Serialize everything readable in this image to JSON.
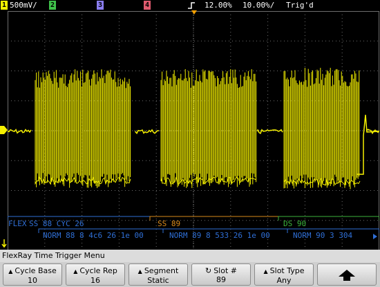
{
  "status_bar": {
    "channels": [
      {
        "number": "1",
        "scale": "500mV/",
        "color": "#f2f200"
      },
      {
        "number": "2",
        "color": "#3fc24a"
      },
      {
        "number": "3",
        "color": "#8a7df0"
      },
      {
        "number": "4",
        "color": "#e05a6e"
      }
    ],
    "trigger_marker": "T",
    "timebase_delay": "12.00%",
    "timebase_scale": "10.00%/",
    "trigger_status": "Trig'd"
  },
  "decode": {
    "line1": {
      "label": "FLEX",
      "frames": [
        {
          "text": "SS 88  CYC 26",
          "color": "#2f6fd6"
        },
        {
          "text": "SS 89",
          "color": "#d98a1a"
        },
        {
          "text": "DS 90",
          "color": "#3bb33b"
        }
      ]
    },
    "line2": {
      "frames": [
        {
          "text": "NORM 88  8  4c6  26  1e 00",
          "color": "#2f6fd6"
        },
        {
          "text": "NORM 89  8  533  26  1e 00",
          "color": "#2f6fd6"
        },
        {
          "text": "NORM 90  3  304",
          "color": "#2f6fd6"
        }
      ]
    }
  },
  "menu": {
    "title": "FlexRay Time Trigger Menu",
    "softkeys": [
      {
        "label": "Cycle Base",
        "value": "10"
      },
      {
        "label": "Cycle Rep",
        "value": "16"
      },
      {
        "label": "Segment",
        "value": "Static"
      },
      {
        "label": "Slot #",
        "value": "89"
      },
      {
        "label": "Slot Type",
        "value": "Any"
      }
    ]
  },
  "colors": {
    "trace": "#f5f000",
    "grid": "#6e6e6e",
    "grid_dots": "#5a5a5a",
    "ground_marker": "#f5f000"
  }
}
